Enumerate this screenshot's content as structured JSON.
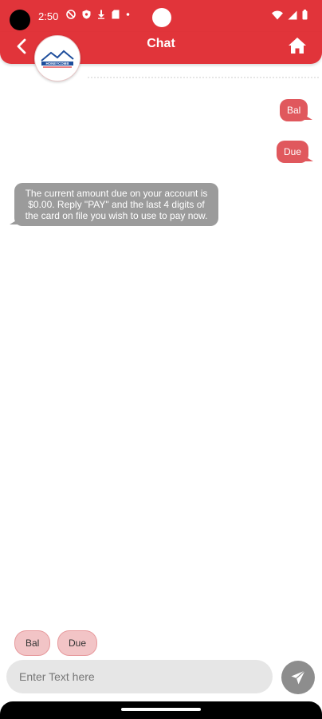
{
  "status_bar": {
    "time": "2:50",
    "icons_left": [
      "do-not-disturb-icon",
      "shield-icon",
      "download-icon",
      "sim-card-icon",
      "dot-icon"
    ],
    "icons_right": [
      "wifi-icon",
      "signal-icon",
      "battery-icon"
    ]
  },
  "header": {
    "title": "Chat",
    "back_icon": "chevron-left-icon",
    "home_icon": "home-icon",
    "logo_text": "HONEYCOMB"
  },
  "messages": [
    {
      "id": "msg1",
      "direction": "outgoing",
      "text": "Bal"
    },
    {
      "id": "msg2",
      "direction": "outgoing",
      "text": "Due"
    },
    {
      "id": "msg3",
      "direction": "incoming",
      "lines": [
        "The current amount due on your account is",
        "$0.00. Reply \"PAY\" and the last 4 digits of",
        "the card on file you wish to use to pay now."
      ]
    }
  ],
  "quick_replies": [
    {
      "label": "Bal"
    },
    {
      "label": "Due"
    }
  ],
  "input": {
    "placeholder": "Enter Text here",
    "value": ""
  },
  "send_icon": "send-icon",
  "colors": {
    "brand_red": "#e1343a",
    "outgoing_bubble": "#e0585d",
    "incoming_bubble": "#9b9b9b",
    "quick_reply_bg": "#f2c4c6",
    "input_bg": "#e6e6e6",
    "send_button": "#8d8d8d"
  }
}
